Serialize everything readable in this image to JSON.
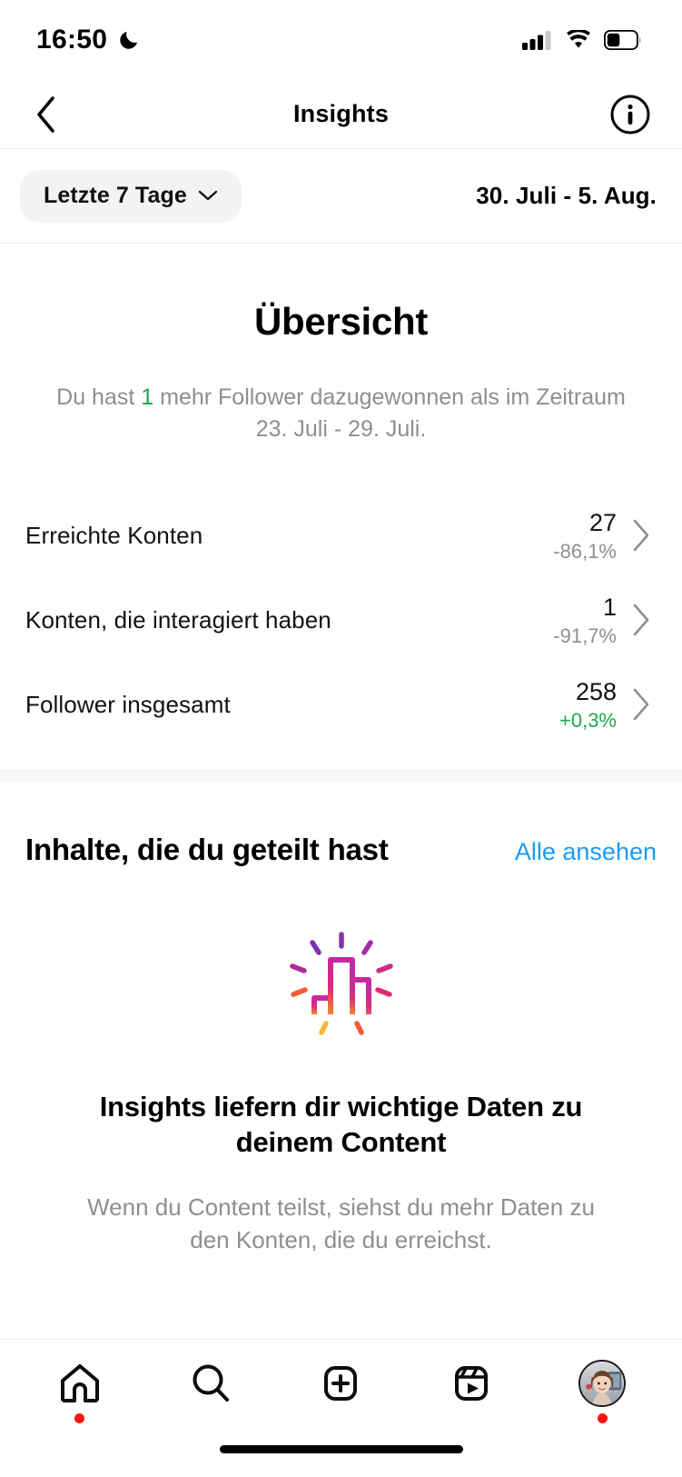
{
  "status_bar": {
    "time": "16:50",
    "dnd_icon": "crescent-moon-icon",
    "cellular_icon": "signal-bars-icon",
    "wifi_icon": "wifi-icon",
    "battery_icon": "battery-icon",
    "battery_level_percent": 40
  },
  "header": {
    "back_icon": "chevron-left-icon",
    "title": "Insights",
    "info_icon": "info-circle-icon"
  },
  "filter_bar": {
    "range_label": "Letzte 7 Tage",
    "chevron_icon": "chevron-down-icon",
    "date_range": "30. Juli - 5. Aug."
  },
  "overview": {
    "title": "Übersicht",
    "summary_prefix": "Du hast ",
    "summary_highlight": "1",
    "summary_suffix": " mehr Follower dazugewonnen als im Zeitraum 23. Juli - 29. Juli.",
    "highlight_color": "#1ea94c",
    "metrics": [
      {
        "label": "Erreichte Konten",
        "value": "27",
        "delta": "-86,1%",
        "delta_positive": false
      },
      {
        "label": "Konten, die interagiert haben",
        "value": "1",
        "delta": "-91,7%",
        "delta_positive": false
      },
      {
        "label": "Follower insgesamt",
        "value": "258",
        "delta": "+0,3%",
        "delta_positive": true
      }
    ],
    "chevron_icon": "chevron-right-icon"
  },
  "shared_content": {
    "title": "Inhalte, die du geteilt hast",
    "see_all_label": "Alle ansehen",
    "see_all_color": "#1a9bf0"
  },
  "empty_state": {
    "icon": "insights-bar-chart-icon",
    "title": "Insights liefern dir wichtige Daten zu deinem Content",
    "body": "Wenn du Content teilst, siehst du mehr Daten zu den Konten, die du erreichst."
  },
  "tab_bar": {
    "tabs": [
      {
        "name": "home",
        "icon": "home-icon",
        "badge": true
      },
      {
        "name": "search",
        "icon": "search-icon",
        "badge": false
      },
      {
        "name": "create",
        "icon": "plus-square-icon",
        "badge": false
      },
      {
        "name": "reels",
        "icon": "reels-icon",
        "badge": false
      },
      {
        "name": "profile",
        "icon": "profile-avatar-icon",
        "badge": true
      }
    ],
    "badge_color": "#fa1414"
  }
}
